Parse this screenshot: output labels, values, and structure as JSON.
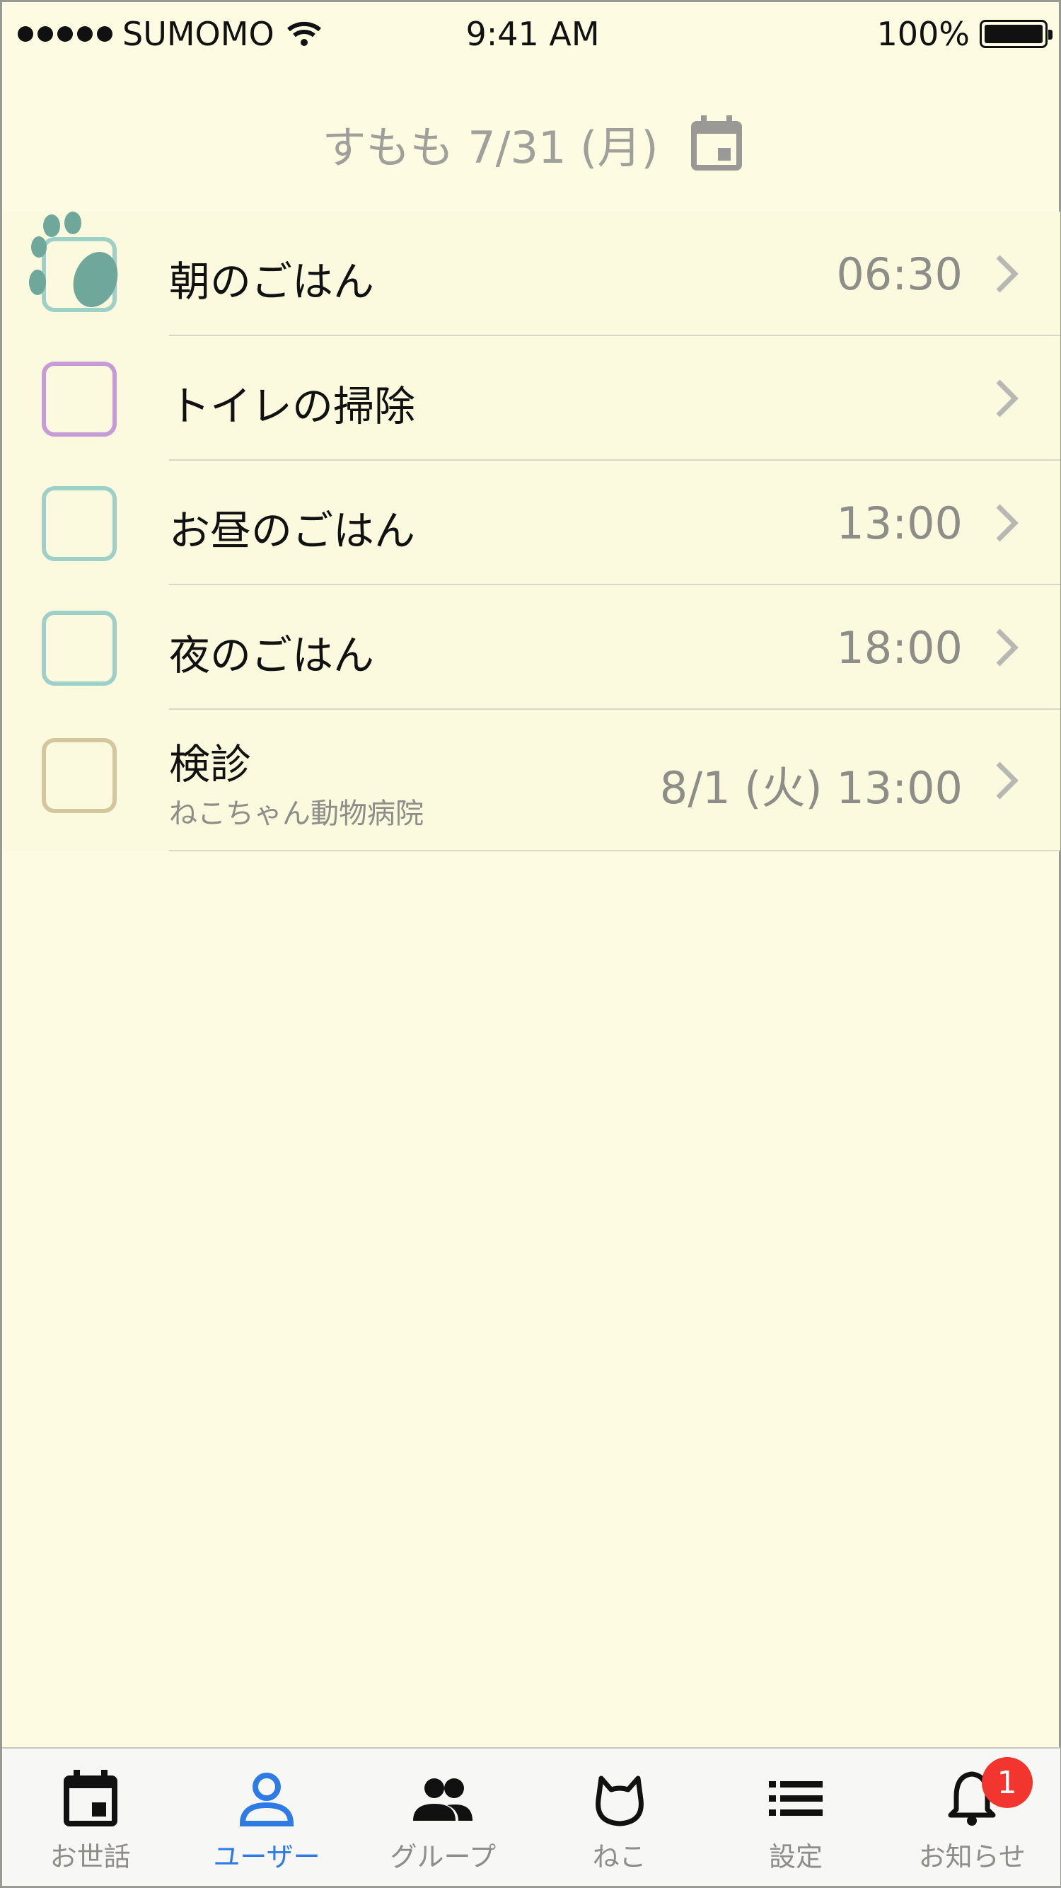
{
  "status_bar": {
    "carrier": "SUMOMO",
    "time": "9:41 AM",
    "battery": "100%"
  },
  "header": {
    "title": "すもも 7/31 (月)",
    "icon": "calendar-icon"
  },
  "tasks": [
    {
      "label": "朝のごはん",
      "time": "06:30",
      "color": "#9fd0c8",
      "checked": true
    },
    {
      "label": "トイレの掃除",
      "time": "",
      "color": "#c79ad8",
      "checked": false
    },
    {
      "label": "お昼のごはん",
      "time": "13:00",
      "color": "#9fd0c8",
      "checked": false
    },
    {
      "label": "夜のごはん",
      "time": "18:00",
      "color": "#9fd0c8",
      "checked": false
    },
    {
      "label": "検診",
      "sublabel": "ねこちゃん動物病院",
      "time": "8/1 (火) 13:00",
      "color": "#d3c79d",
      "checked": false
    }
  ],
  "tabs": [
    {
      "label": "お世話",
      "icon": "calendar-icon"
    },
    {
      "label": "ユーザー",
      "icon": "user-icon",
      "active": true
    },
    {
      "label": "グループ",
      "icon": "group-icon"
    },
    {
      "label": "ねこ",
      "icon": "cat-icon"
    },
    {
      "label": "設定",
      "icon": "list-icon"
    },
    {
      "label": "お知らせ",
      "icon": "bell-icon",
      "badge": "1"
    }
  ]
}
